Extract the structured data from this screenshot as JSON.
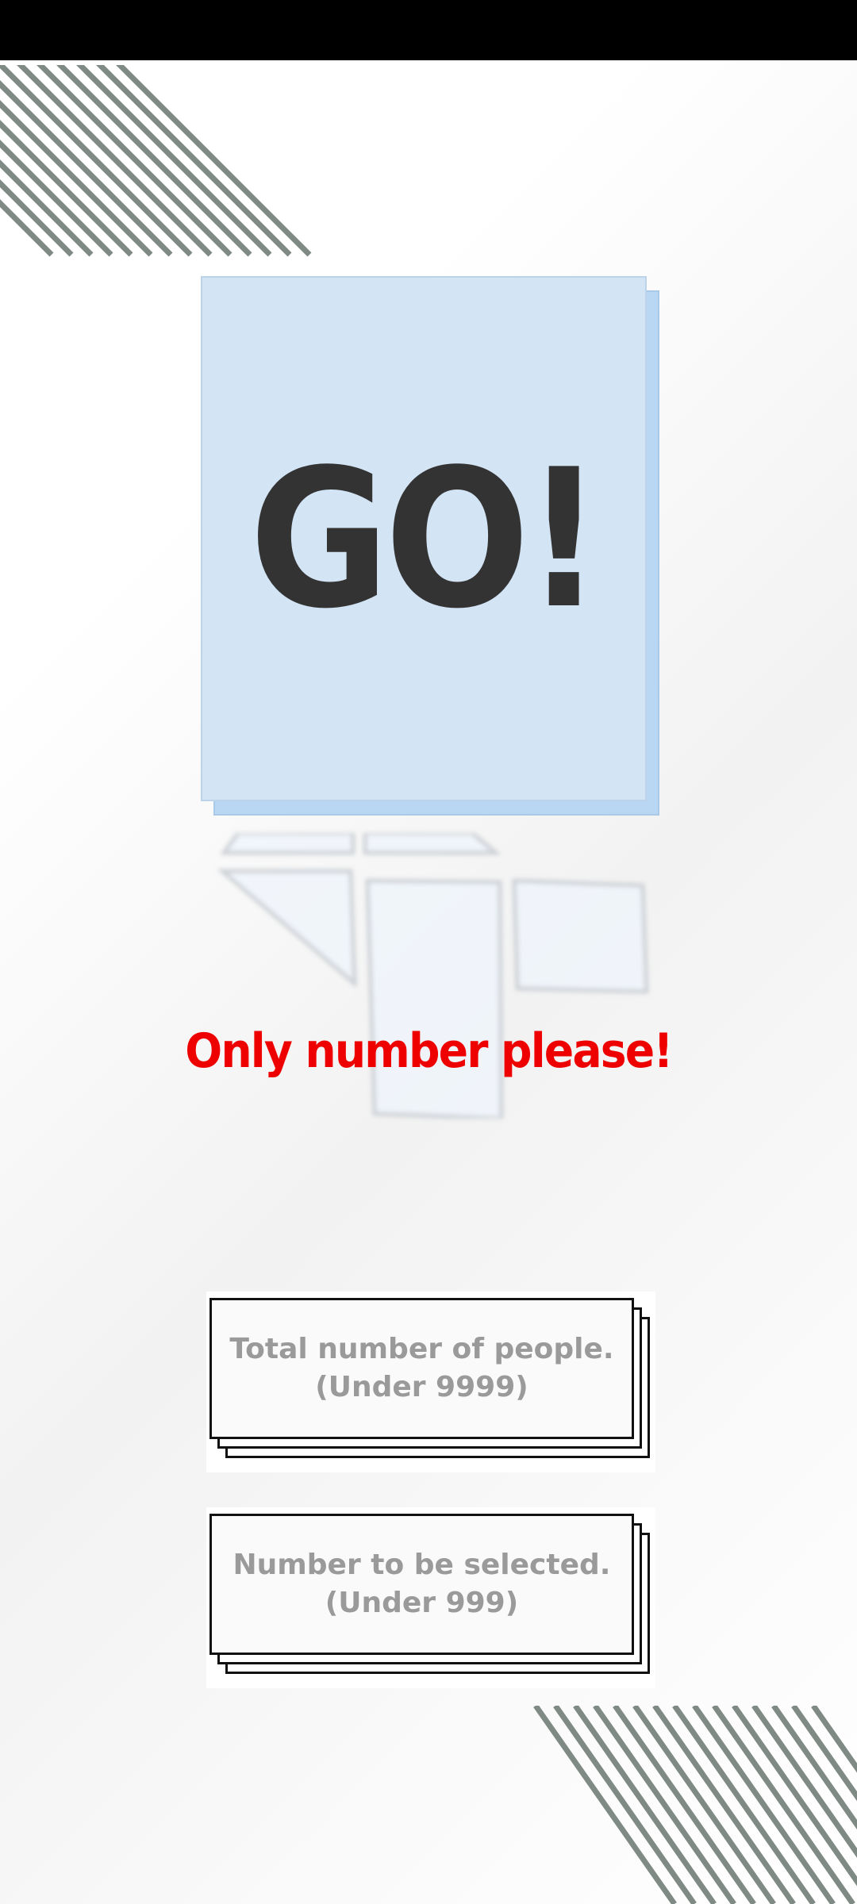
{
  "main": {
    "go_button_label": "GO!",
    "warning_message": "Only number please!"
  },
  "inputs": {
    "total_people": {
      "placeholder": "Total number of people.\n(Under 9999)",
      "value": ""
    },
    "selected_count": {
      "placeholder": "Number to be selected.\n(Under 999)",
      "value": ""
    }
  },
  "colors": {
    "go_card": "#d3e4f4",
    "go_card_shadow": "#b9d7f2",
    "go_text": "#333333",
    "warning": "#ee0000",
    "placeholder_text": "#9a9a9a",
    "stripes": "#7f8a85"
  }
}
